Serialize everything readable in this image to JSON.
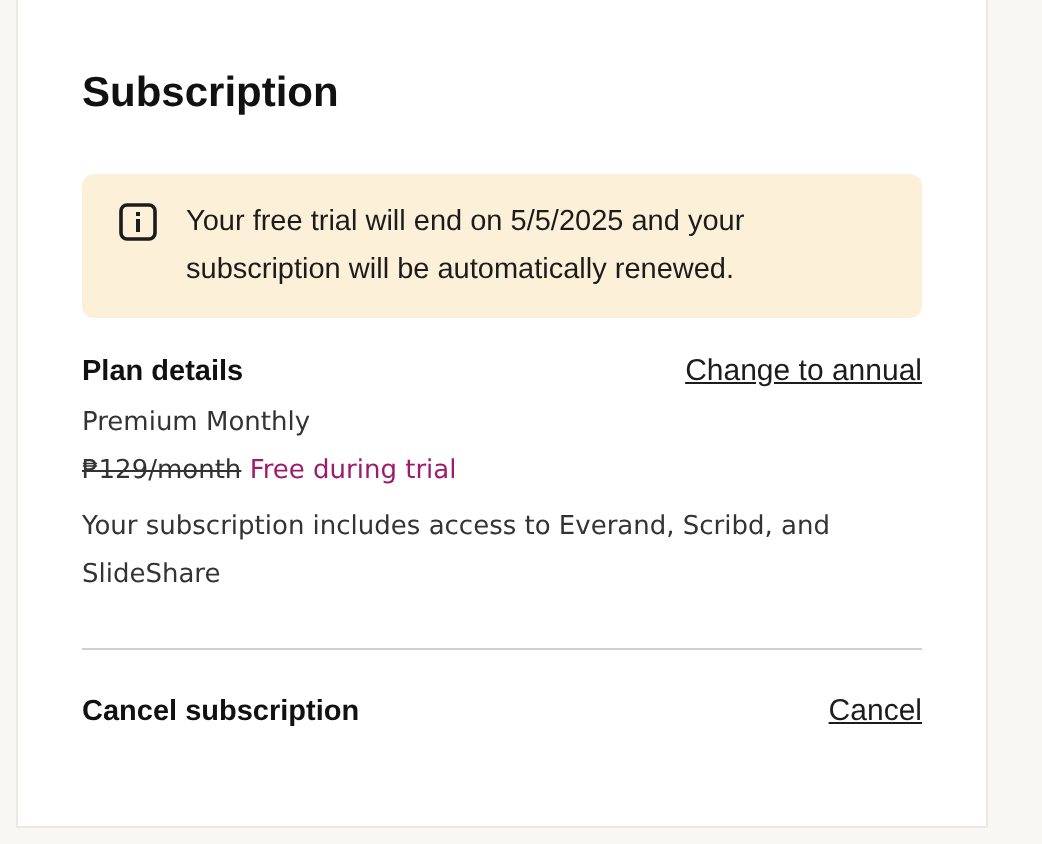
{
  "title": "Subscription",
  "notice": {
    "text": "Your free trial will end on 5/5/2025 and your subscription will be automatically renewed."
  },
  "plan": {
    "heading": "Plan details",
    "link": "Change to annual",
    "name": "Premium Monthly",
    "old_price": "₱129/month",
    "trial_price": "Free during trial",
    "description": "Your subscription includes access to Everand, Scribd, and SlideShare"
  },
  "cancel": {
    "label": "Cancel subscription",
    "link": "Cancel"
  }
}
